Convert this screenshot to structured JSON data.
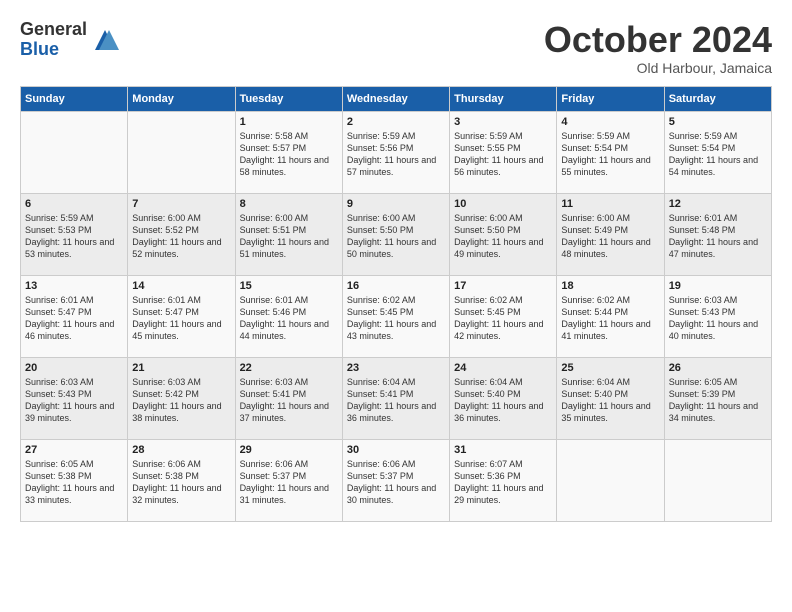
{
  "logo": {
    "general": "General",
    "blue": "Blue"
  },
  "title": "October 2024",
  "location": "Old Harbour, Jamaica",
  "days_header": [
    "Sunday",
    "Monday",
    "Tuesday",
    "Wednesday",
    "Thursday",
    "Friday",
    "Saturday"
  ],
  "weeks": [
    [
      {
        "day": "",
        "info": ""
      },
      {
        "day": "",
        "info": ""
      },
      {
        "day": "1",
        "info": "Sunrise: 5:58 AM\nSunset: 5:57 PM\nDaylight: 11 hours and 58 minutes."
      },
      {
        "day": "2",
        "info": "Sunrise: 5:59 AM\nSunset: 5:56 PM\nDaylight: 11 hours and 57 minutes."
      },
      {
        "day": "3",
        "info": "Sunrise: 5:59 AM\nSunset: 5:55 PM\nDaylight: 11 hours and 56 minutes."
      },
      {
        "day": "4",
        "info": "Sunrise: 5:59 AM\nSunset: 5:54 PM\nDaylight: 11 hours and 55 minutes."
      },
      {
        "day": "5",
        "info": "Sunrise: 5:59 AM\nSunset: 5:54 PM\nDaylight: 11 hours and 54 minutes."
      }
    ],
    [
      {
        "day": "6",
        "info": "Sunrise: 5:59 AM\nSunset: 5:53 PM\nDaylight: 11 hours and 53 minutes."
      },
      {
        "day": "7",
        "info": "Sunrise: 6:00 AM\nSunset: 5:52 PM\nDaylight: 11 hours and 52 minutes."
      },
      {
        "day": "8",
        "info": "Sunrise: 6:00 AM\nSunset: 5:51 PM\nDaylight: 11 hours and 51 minutes."
      },
      {
        "day": "9",
        "info": "Sunrise: 6:00 AM\nSunset: 5:50 PM\nDaylight: 11 hours and 50 minutes."
      },
      {
        "day": "10",
        "info": "Sunrise: 6:00 AM\nSunset: 5:50 PM\nDaylight: 11 hours and 49 minutes."
      },
      {
        "day": "11",
        "info": "Sunrise: 6:00 AM\nSunset: 5:49 PM\nDaylight: 11 hours and 48 minutes."
      },
      {
        "day": "12",
        "info": "Sunrise: 6:01 AM\nSunset: 5:48 PM\nDaylight: 11 hours and 47 minutes."
      }
    ],
    [
      {
        "day": "13",
        "info": "Sunrise: 6:01 AM\nSunset: 5:47 PM\nDaylight: 11 hours and 46 minutes."
      },
      {
        "day": "14",
        "info": "Sunrise: 6:01 AM\nSunset: 5:47 PM\nDaylight: 11 hours and 45 minutes."
      },
      {
        "day": "15",
        "info": "Sunrise: 6:01 AM\nSunset: 5:46 PM\nDaylight: 11 hours and 44 minutes."
      },
      {
        "day": "16",
        "info": "Sunrise: 6:02 AM\nSunset: 5:45 PM\nDaylight: 11 hours and 43 minutes."
      },
      {
        "day": "17",
        "info": "Sunrise: 6:02 AM\nSunset: 5:45 PM\nDaylight: 11 hours and 42 minutes."
      },
      {
        "day": "18",
        "info": "Sunrise: 6:02 AM\nSunset: 5:44 PM\nDaylight: 11 hours and 41 minutes."
      },
      {
        "day": "19",
        "info": "Sunrise: 6:03 AM\nSunset: 5:43 PM\nDaylight: 11 hours and 40 minutes."
      }
    ],
    [
      {
        "day": "20",
        "info": "Sunrise: 6:03 AM\nSunset: 5:43 PM\nDaylight: 11 hours and 39 minutes."
      },
      {
        "day": "21",
        "info": "Sunrise: 6:03 AM\nSunset: 5:42 PM\nDaylight: 11 hours and 38 minutes."
      },
      {
        "day": "22",
        "info": "Sunrise: 6:03 AM\nSunset: 5:41 PM\nDaylight: 11 hours and 37 minutes."
      },
      {
        "day": "23",
        "info": "Sunrise: 6:04 AM\nSunset: 5:41 PM\nDaylight: 11 hours and 36 minutes."
      },
      {
        "day": "24",
        "info": "Sunrise: 6:04 AM\nSunset: 5:40 PM\nDaylight: 11 hours and 36 minutes."
      },
      {
        "day": "25",
        "info": "Sunrise: 6:04 AM\nSunset: 5:40 PM\nDaylight: 11 hours and 35 minutes."
      },
      {
        "day": "26",
        "info": "Sunrise: 6:05 AM\nSunset: 5:39 PM\nDaylight: 11 hours and 34 minutes."
      }
    ],
    [
      {
        "day": "27",
        "info": "Sunrise: 6:05 AM\nSunset: 5:38 PM\nDaylight: 11 hours and 33 minutes."
      },
      {
        "day": "28",
        "info": "Sunrise: 6:06 AM\nSunset: 5:38 PM\nDaylight: 11 hours and 32 minutes."
      },
      {
        "day": "29",
        "info": "Sunrise: 6:06 AM\nSunset: 5:37 PM\nDaylight: 11 hours and 31 minutes."
      },
      {
        "day": "30",
        "info": "Sunrise: 6:06 AM\nSunset: 5:37 PM\nDaylight: 11 hours and 30 minutes."
      },
      {
        "day": "31",
        "info": "Sunrise: 6:07 AM\nSunset: 5:36 PM\nDaylight: 11 hours and 29 minutes."
      },
      {
        "day": "",
        "info": ""
      },
      {
        "day": "",
        "info": ""
      }
    ]
  ]
}
